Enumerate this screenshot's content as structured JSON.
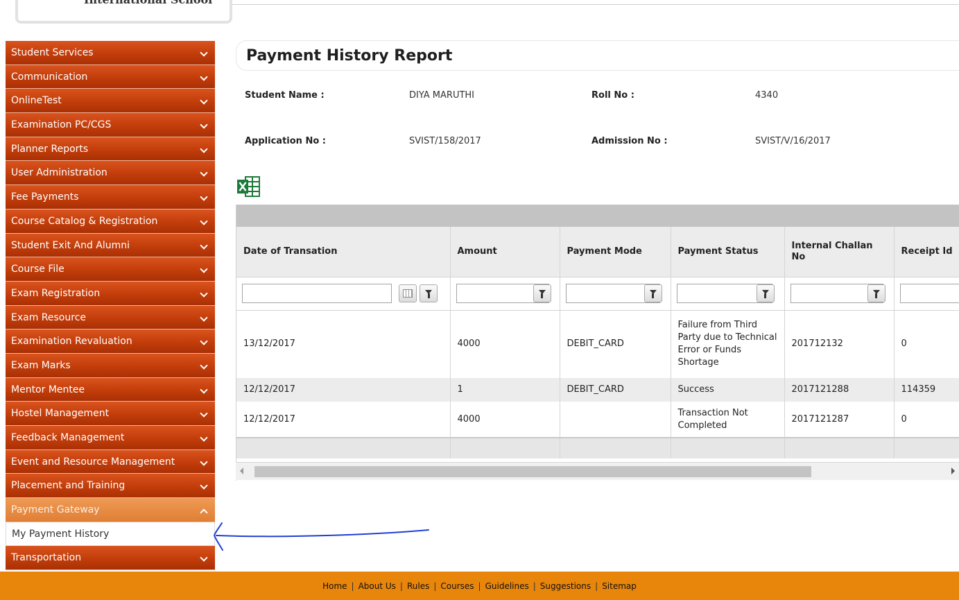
{
  "header": {
    "logo_text": "International School",
    "title": "Payment History Report"
  },
  "sidebar": {
    "items": [
      {
        "label": "Student Services"
      },
      {
        "label": "Communication"
      },
      {
        "label": "OnlineTest"
      },
      {
        "label": "Examination PC/CGS"
      },
      {
        "label": "Planner Reports"
      },
      {
        "label": "User Administration"
      },
      {
        "label": "Fee Payments"
      },
      {
        "label": "Course Catalog & Registration"
      },
      {
        "label": "Student Exit And Alumni"
      },
      {
        "label": "Course File"
      },
      {
        "label": "Exam Registration"
      },
      {
        "label": "Exam Resource"
      },
      {
        "label": "Examination Revaluation"
      },
      {
        "label": "Exam Marks"
      },
      {
        "label": "Mentor Mentee"
      },
      {
        "label": "Hostel Management"
      },
      {
        "label": "Feedback Management"
      },
      {
        "label": "Event and Resource Management"
      },
      {
        "label": "Placement and Training"
      },
      {
        "label": "Payment Gateway"
      },
      {
        "label": "Transportation"
      }
    ],
    "active_item": "Payment Gateway",
    "sub_item": "My Payment History"
  },
  "student": {
    "name_label": "Student Name :",
    "name_value": "DIYA MARUTHI",
    "roll_label": "Roll No :",
    "roll_value": "4340",
    "app_label": "Application No :",
    "app_value": "SVIST/158/2017",
    "adm_label": "Admission No :",
    "adm_value": "SVIST/V/16/2017"
  },
  "grid": {
    "columns": [
      "Date of Transation",
      "Amount",
      "Payment Mode",
      "Payment Status",
      "Internal Challan No",
      "Receipt Id"
    ],
    "rows": [
      [
        "13/12/2017",
        "4000",
        "DEBIT_CARD",
        "Failure from Third Party due to Technical Error or Funds Shortage",
        "201712132",
        "0"
      ],
      [
        "12/12/2017",
        "1",
        "DEBIT_CARD",
        "Success",
        "2017121288",
        "114359"
      ],
      [
        "12/12/2017",
        "4000",
        "",
        "Transaction Not Completed",
        "2017121287",
        "0"
      ]
    ]
  },
  "footer": {
    "links": [
      "Home",
      "About Us",
      "Rules",
      "Courses",
      "Guidelines",
      "Suggestions",
      "Sitemap"
    ],
    "separator": "|"
  },
  "colors": {
    "menu": "#c23d0a",
    "menu_active": "#e88c45",
    "footer": "#e8850b",
    "annotation_arrow": "#1f3fd6",
    "excel_green": "#1d7a3a"
  },
  "icons": {
    "export": "excel-icon",
    "filter": "filter-icon",
    "calendar": "calendar-icon",
    "menu_chevron": "chevron-down-icon"
  }
}
